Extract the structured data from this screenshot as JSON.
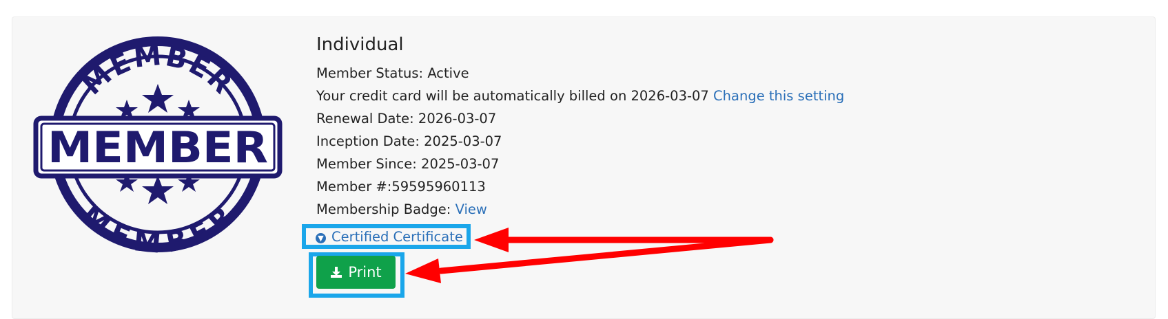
{
  "membership": {
    "title": "Individual",
    "status": "Member Status: Active",
    "billing_text": "Your credit card will be automatically billed on 2026-03-07",
    "billing_link": "Change this setting",
    "renewal": "Renewal Date: 2026-03-07",
    "inception": "Inception Date: 2025-03-07",
    "since": "Member Since: 2025-03-07",
    "number": "Member #:59595960113",
    "badge_label": "Membership Badge:",
    "badge_link": "View",
    "certificate_link": "Certified Certificate",
    "print_label": "Print"
  },
  "logo": {
    "main_word": "MEMBER",
    "ring_word": "MEMBER"
  },
  "colors": {
    "link": "#2a6fb8",
    "button": "#0fa14a",
    "highlight": "#1aa6ea",
    "arrow": "#ff0000",
    "stamp": "#1f1a6e"
  },
  "icons": {
    "certificate": "circle-arrow-down-icon",
    "print": "download-icon"
  }
}
